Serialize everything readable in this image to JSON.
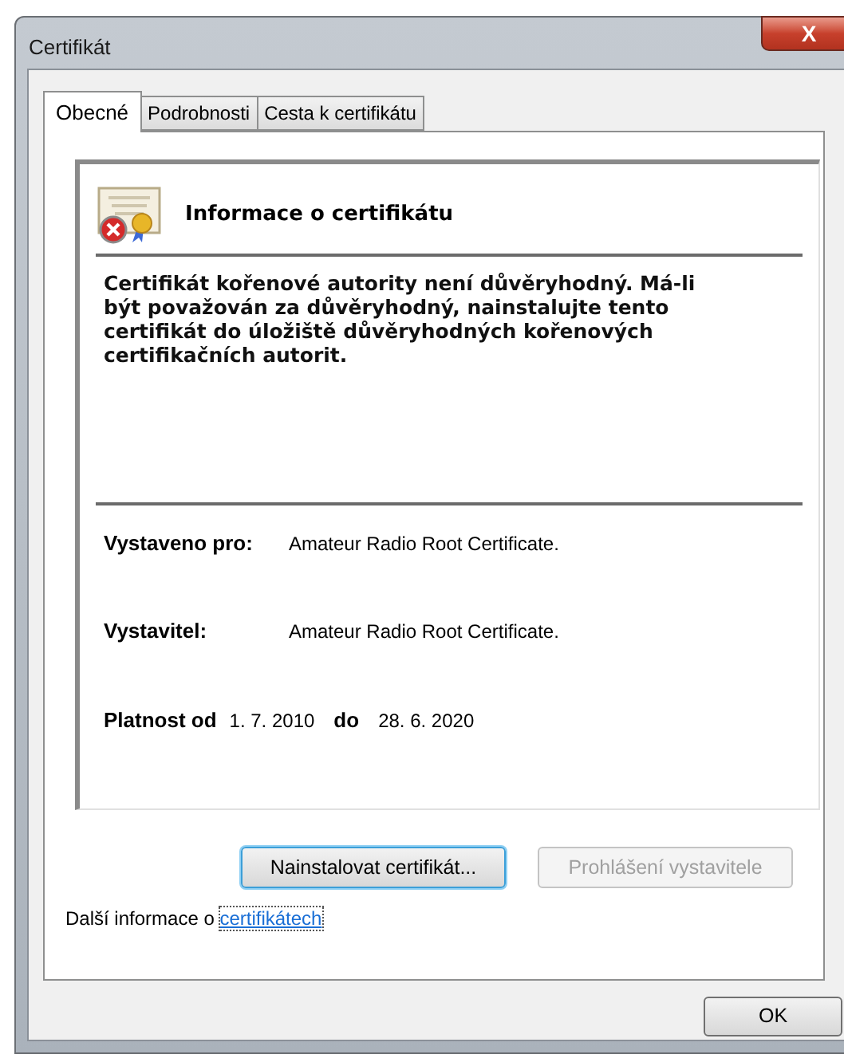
{
  "window": {
    "title": "Certifikát",
    "close": "X"
  },
  "tabs": [
    {
      "label": "Obecné",
      "selected": true
    },
    {
      "label": "Podrobnosti",
      "selected": false
    },
    {
      "label": "Cesta k certifikátu",
      "selected": false
    }
  ],
  "info": {
    "heading": "Informace o certifikátu",
    "message": "Certifikát kořenové autority není důvěryhodný. Má-li být považován za důvěryhodný, nainstalujte tento certifikát do úložiště důvěryhodných kořenových certifikačních autorit.",
    "trusted": false
  },
  "details": [
    {
      "label": "Vystaveno pro:",
      "value": "Amateur Radio Root Certificate."
    },
    {
      "label": "Vystavitel:",
      "value": "Amateur Radio Root Certificate."
    }
  ],
  "validity": {
    "from_label": "Platnost od",
    "from": "1. 7. 2010",
    "to_label": "do",
    "to": "28. 6. 2020"
  },
  "buttons": [
    {
      "label": "Nainstalovat certifikát...",
      "disabled": false,
      "focused": true
    },
    {
      "label": "Prohlášení vystavitele",
      "disabled": true,
      "focused": false
    }
  ],
  "more_info": {
    "text": "Další informace o ",
    "link": "certifikátech"
  },
  "ok_button": "OK"
}
